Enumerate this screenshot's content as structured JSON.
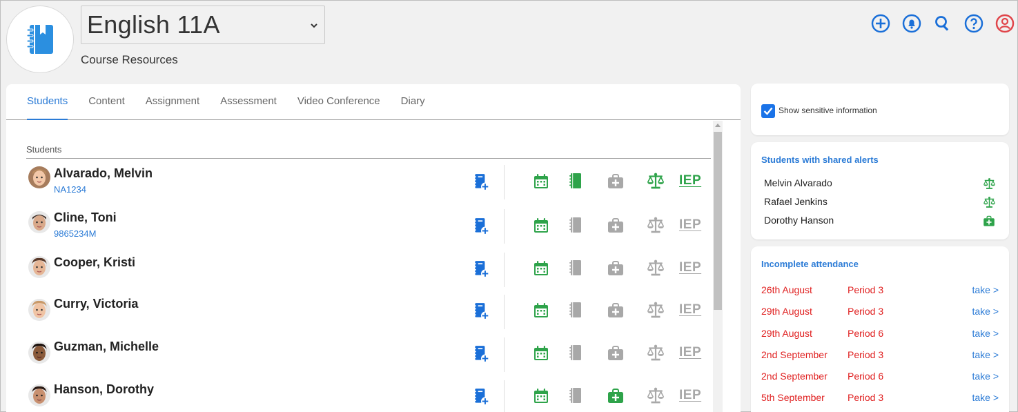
{
  "header": {
    "course_selected": "English 11A",
    "subtitle": "Course Resources"
  },
  "top_icons": [
    "add-circle-icon",
    "bell-icon",
    "search-icon",
    "help-icon",
    "user-account-icon"
  ],
  "tabs": [
    {
      "label": "Students",
      "active": true
    },
    {
      "label": "Content"
    },
    {
      "label": "Assignment"
    },
    {
      "label": "Assessment"
    },
    {
      "label": "Video Conference"
    },
    {
      "label": "Diary"
    }
  ],
  "students_section": {
    "label": "Students",
    "iep_label": "IEP",
    "rows": [
      {
        "name": "Alvarado, Melvin",
        "id": "NA1234",
        "notebook": true,
        "medical": false,
        "legal": true,
        "iep": true
      },
      {
        "name": "Cline, Toni",
        "id": "9865234M",
        "notebook": false,
        "medical": false,
        "legal": false,
        "iep": false
      },
      {
        "name": "Cooper, Kristi",
        "id": "",
        "notebook": false,
        "medical": false,
        "legal": false,
        "iep": false
      },
      {
        "name": "Curry, Victoria",
        "id": "",
        "notebook": false,
        "medical": false,
        "legal": false,
        "iep": false
      },
      {
        "name": "Guzman, Michelle",
        "id": "",
        "notebook": false,
        "medical": false,
        "legal": false,
        "iep": false
      },
      {
        "name": "Hanson, Dorothy",
        "id": "",
        "notebook": false,
        "medical": true,
        "legal": false,
        "iep": false
      }
    ]
  },
  "sensitive": {
    "label": "Show sensitive information",
    "checked": true
  },
  "shared_alerts": {
    "title": "Students with shared alerts",
    "items": [
      {
        "name": "Melvin Alvarado",
        "icon": "scales-icon"
      },
      {
        "name": "Rafael Jenkins",
        "icon": "scales-icon"
      },
      {
        "name": "Dorothy Hanson",
        "icon": "medical-kit-icon"
      }
    ]
  },
  "incomplete_attendance": {
    "title": "Incomplete attendance",
    "take_label": "take >",
    "items": [
      {
        "date": "26th August",
        "period": "Period 3"
      },
      {
        "date": "29th August",
        "period": "Period 3"
      },
      {
        "date": "29th August",
        "period": "Period 6"
      },
      {
        "date": "2nd September",
        "period": "Period 3"
      },
      {
        "date": "2nd September",
        "period": "Period 6"
      },
      {
        "date": "5th September",
        "period": "Period 3"
      }
    ]
  },
  "colors": {
    "blue": "#2b7bd6",
    "green": "#2ea34a",
    "grey": "#a8a8a8",
    "red": "#e02020",
    "icon_blue": "#1a6fd8"
  }
}
